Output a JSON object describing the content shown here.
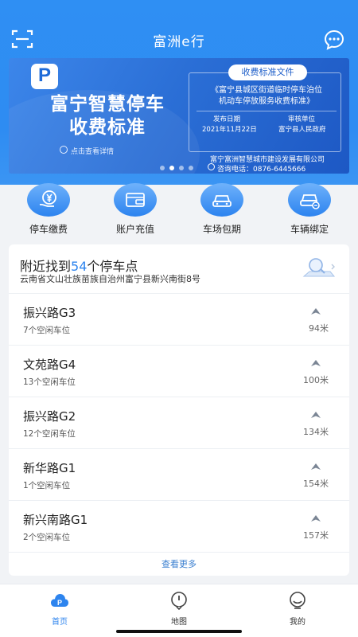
{
  "header": {
    "title": "富洲e行"
  },
  "banner": {
    "headline_line1": "富宁智慧停车",
    "headline_line2": "收费标准",
    "cta": "点击查看详情",
    "doc_tag": "收费标准文件",
    "doc_title_line1": "《富宁县城区街道临时停车泊位",
    "doc_title_line2": "机动车停放服务收费标准》",
    "publish_label": "发布日期",
    "publish_date": "2021年11月22日",
    "reviewer_label": "审核单位",
    "reviewer": "富宁县人民政府",
    "company": "富宁富洲智慧城市建设发展有限公司",
    "phone": "咨询电话：0876-6445666",
    "slides": 4,
    "active_slide": 1
  },
  "actions": [
    {
      "label": "停车缴费",
      "icon": "yuan-hand-icon"
    },
    {
      "label": "账户充值",
      "icon": "wallet-icon"
    },
    {
      "label": "车场包期",
      "icon": "car-icon"
    },
    {
      "label": "车辆绑定",
      "icon": "car-link-icon"
    }
  ],
  "nearby": {
    "title_prefix": "附近找到",
    "count": "54",
    "title_suffix": "个停车点",
    "address": "云南省文山壮族苗族自治州富宁县新兴南街8号",
    "see_more": "查看更多",
    "lots": [
      {
        "name": "振兴路G3",
        "free": "7个空闲车位",
        "distance": "94米"
      },
      {
        "name": "文苑路G4",
        "free": "13个空闲车位",
        "distance": "100米"
      },
      {
        "name": "振兴路G2",
        "free": "12个空闲车位",
        "distance": "134米"
      },
      {
        "name": "新华路G1",
        "free": "1个空闲车位",
        "distance": "154米"
      },
      {
        "name": "新兴南路G1",
        "free": "2个空闲车位",
        "distance": "157米"
      }
    ]
  },
  "tabbar": {
    "items": [
      {
        "label": "首页",
        "icon": "home-parking-icon",
        "active": true
      },
      {
        "label": "地图",
        "icon": "map-pin-icon",
        "active": false
      },
      {
        "label": "我的",
        "icon": "profile-icon",
        "active": false
      }
    ]
  },
  "colors": {
    "primary": "#2e8cf2",
    "accent_text": "#2d84ee",
    "background": "#f1f3f6"
  }
}
